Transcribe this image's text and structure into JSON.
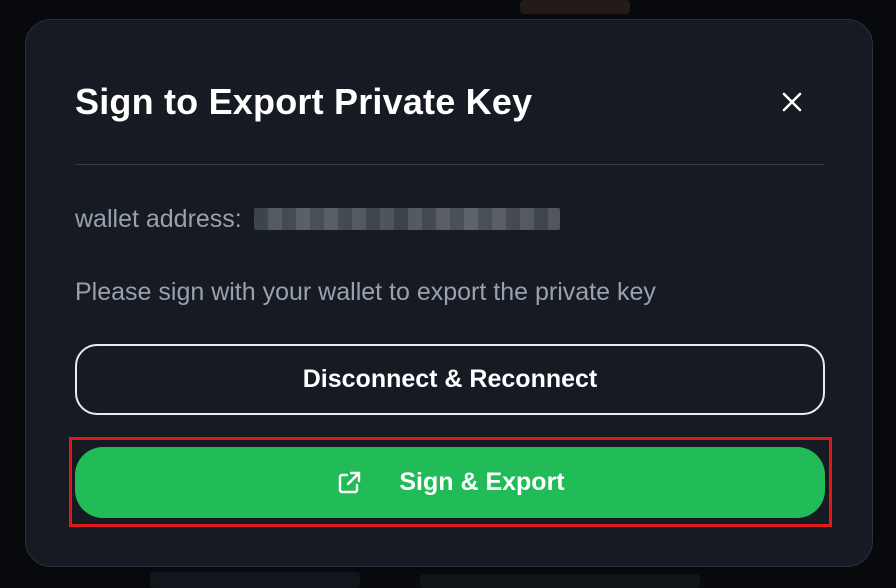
{
  "modal": {
    "title": "Sign to Export Private Key",
    "close_icon": "close-icon",
    "wallet_label": "wallet address:",
    "wallet_value": "",
    "instruction": "Please sign with your wallet to export the private key",
    "disconnect_button_label": "Disconnect & Reconnect",
    "sign_export_button_label": "Sign & Export",
    "sign_export_icon": "external-link-icon"
  },
  "colors": {
    "modal_background": "#151a23",
    "primary_button": "#21bc57",
    "muted_text": "#9aa1ac",
    "highlight_border": "#e01919"
  }
}
